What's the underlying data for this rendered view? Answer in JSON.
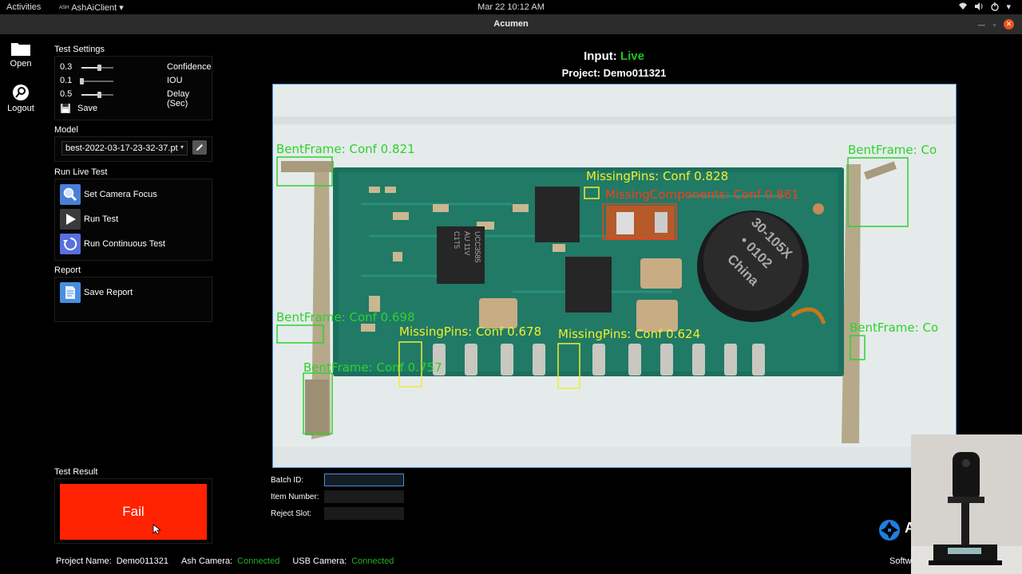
{
  "topbar": {
    "activities": "Activities",
    "app_prefix": "ASH",
    "app_name": "AshAiClient",
    "app_caret": "▾",
    "clock": "Mar 22  10:12 AM",
    "tray": [
      "wifi-icon",
      "volume-icon",
      "power-icon"
    ],
    "tray_caret": "▾"
  },
  "window": {
    "title": "Acumen",
    "minimize": "—",
    "maximize": "▫",
    "close": "✕"
  },
  "sidebar": {
    "open_label": "Open",
    "logout_label": "Logout"
  },
  "test_settings": {
    "heading": "Test Settings",
    "rows": [
      {
        "value": "0.3",
        "name": "Confidence",
        "level": 0.55
      },
      {
        "value": "0.1",
        "name": "IOU",
        "level": 0.0
      },
      {
        "value": "0.5",
        "name": "Delay (Sec)",
        "level": 0.55
      }
    ],
    "save_label": "Save"
  },
  "model": {
    "heading": "Model",
    "selected": "best-2022-03-17-23-32-37.pt"
  },
  "run_live_test": {
    "heading": "Run Live Test",
    "set_focus_label": "Set Camera Focus",
    "run_test_label": "Run Test",
    "run_continuous_label": "Run Continuous Test"
  },
  "report": {
    "heading": "Report",
    "save_report_label": "Save Report"
  },
  "input": {
    "prefix": "Input:",
    "status": "Live",
    "project_line": "Project: Demo011321"
  },
  "detections": [
    {
      "label": "BentFrame: Conf 0.821",
      "color": "#2ed12e"
    },
    {
      "label": "BentFrame: Co",
      "color": "#2ed12e"
    },
    {
      "label": "MissingPins: Conf 0.828",
      "color": "#f2ee2a"
    },
    {
      "label": "MissingComponents: Conf 0.861",
      "color": "#ff3a1a"
    },
    {
      "label": "BentFrame: Conf 0.698",
      "color": "#2ed12e"
    },
    {
      "label": "MissingPins: Conf 0.678",
      "color": "#f2ee2a"
    },
    {
      "label": "MissingPins: Conf 0.624",
      "color": "#f2ee2a"
    },
    {
      "label": "BentFrame: Co",
      "color": "#2ed12e"
    },
    {
      "label": "BentFrame: Conf 0.757",
      "color": "#2ed12e"
    }
  ],
  "board_text": {
    "chip": [
      "UCC3585",
      "AU 11V",
      "C1T5"
    ],
    "inductor": [
      "30-105X",
      "• 0102",
      "China"
    ]
  },
  "batch": {
    "batch_id_label": "Batch ID:",
    "item_number_label": "Item Number:",
    "reject_slot_label": "Reject Slot:",
    "batch_id_value": "",
    "item_number_value": "",
    "reject_slot_value": ""
  },
  "test_result": {
    "heading": "Test Result",
    "value": "Fail",
    "color": "#ff2200"
  },
  "statusbar": {
    "project_name_label": "Project Name:",
    "project_name_value": "Demo011321",
    "ash_camera_label": "Ash Camera:",
    "ash_camera_value": "Connected",
    "usb_camera_label": "USB Camera:",
    "usb_camera_value": "Connected"
  },
  "branding": {
    "letter": "A",
    "software_text": "Softw"
  }
}
